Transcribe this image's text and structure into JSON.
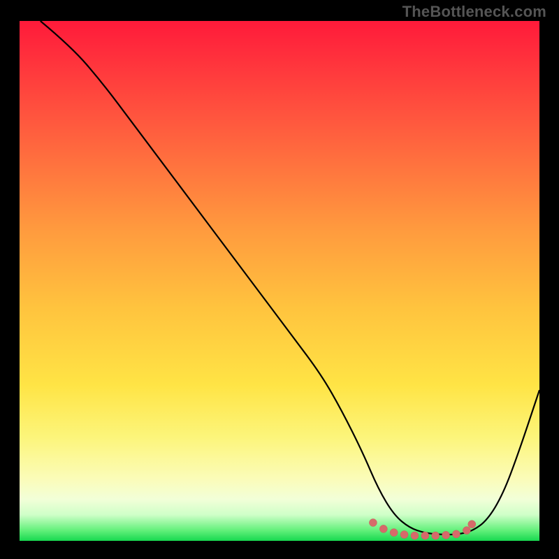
{
  "watermark": "TheBottleneck.com",
  "chart_data": {
    "type": "line",
    "title": "",
    "xlabel": "",
    "ylabel": "",
    "xlim": [
      0,
      100
    ],
    "ylim": [
      0,
      100
    ],
    "grid": false,
    "legend": false,
    "background": {
      "gradient": "red-yellow-green-vertical",
      "top_color": "#ff1a3a",
      "mid_color": "#ffe445",
      "bottom_color": "#18d850"
    },
    "series": [
      {
        "name": "curve",
        "color": "#000000",
        "x": [
          4,
          10,
          16,
          22,
          28,
          34,
          40,
          46,
          52,
          58,
          62,
          66,
          69,
          72,
          75,
          78,
          81,
          84,
          87,
          90,
          93,
          96,
          100
        ],
        "y": [
          100,
          95,
          88,
          80,
          72,
          64,
          56,
          48,
          40,
          32,
          25,
          17,
          10,
          5,
          2.5,
          1.5,
          1.2,
          1.2,
          1.8,
          4,
          9,
          17,
          29
        ]
      },
      {
        "name": "bottom-dots",
        "type": "scatter",
        "color": "#d66a6a",
        "x": [
          68,
          70,
          72,
          74,
          76,
          78,
          80,
          82,
          84,
          86,
          87
        ],
        "y": [
          3.5,
          2.3,
          1.6,
          1.2,
          1.0,
          1.0,
          1.0,
          1.1,
          1.3,
          2.0,
          3.2
        ]
      }
    ]
  },
  "colors": {
    "frame": "#000000",
    "watermark": "#555555"
  }
}
